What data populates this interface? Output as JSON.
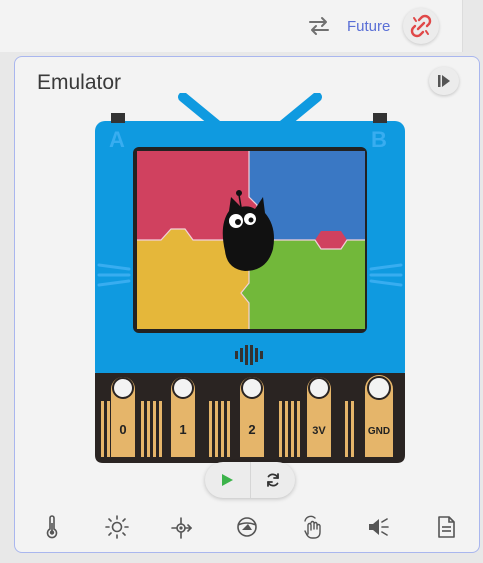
{
  "topbar": {
    "future_label": "Future"
  },
  "emulator": {
    "title": "Emulator",
    "buttons": {
      "a": "A",
      "b": "B"
    },
    "pins": [
      "0",
      "1",
      "2",
      "3V",
      "GND"
    ]
  },
  "colors": {
    "accent": "#5a6fd6",
    "disconnect_icon": "#e04848",
    "play_icon": "#3cb34a",
    "device_blue": "#0f9ae0",
    "tile_red": "#d0415f",
    "tile_blue": "#3a78c4",
    "tile_yellow": "#e5b73a",
    "tile_green": "#72b83a"
  },
  "sensors": [
    "thermometer-icon",
    "light-icon",
    "compass-icon",
    "gesture-icon",
    "touch-icon",
    "sound-icon",
    "log-icon"
  ]
}
